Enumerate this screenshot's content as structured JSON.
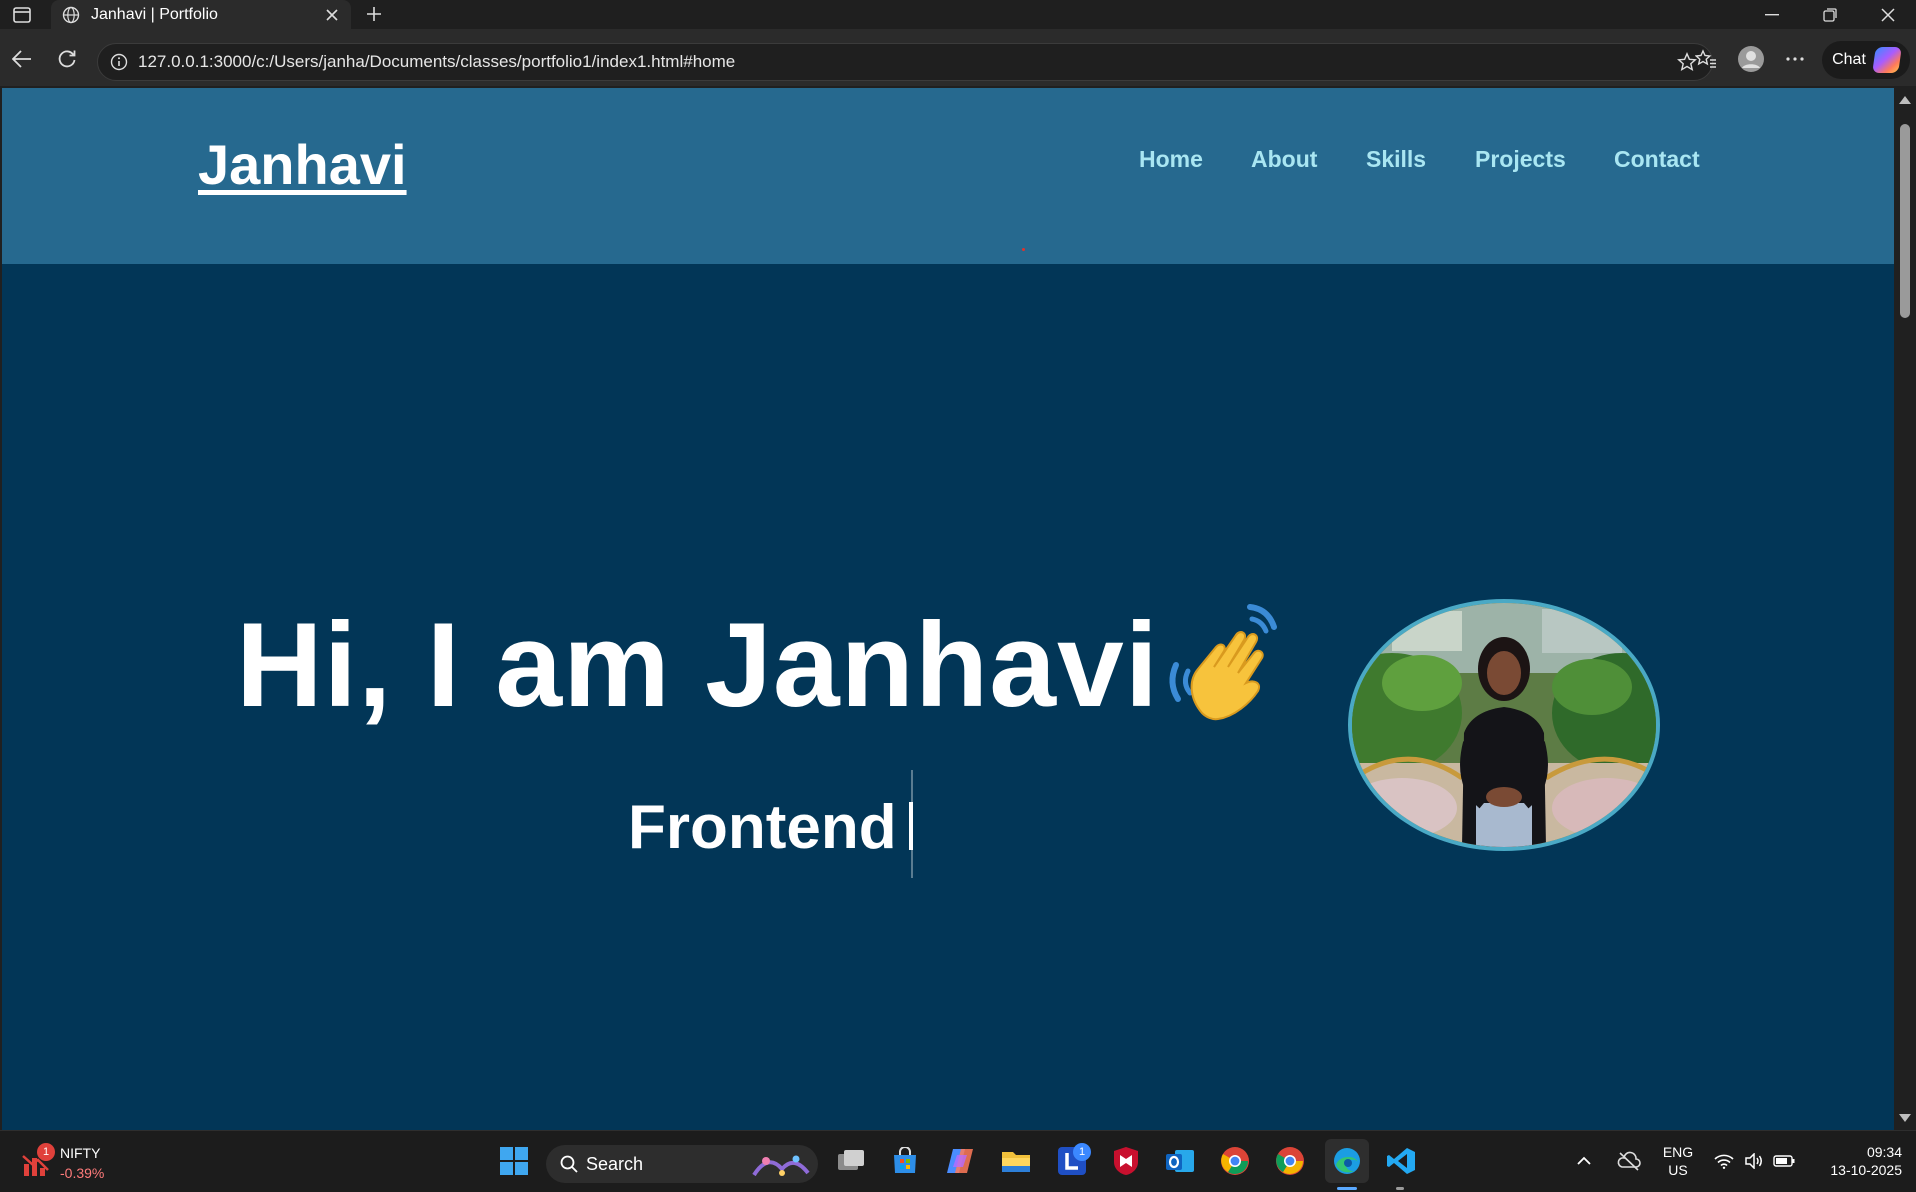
{
  "browser": {
    "tab_title": "Janhavi | Portfolio",
    "url": "127.0.0.1:3000/c:/Users/janha/Documents/classes/portfolio1/index1.html#home",
    "chat_label": "Chat"
  },
  "site": {
    "logo": "Janhavi",
    "nav": [
      "Home",
      "About",
      "Skills",
      "Projects",
      "Contact"
    ],
    "hero_title": "Hi, I am Janhavi",
    "typed_text": "Frontend",
    "colors": {
      "header_bg": "#26698f",
      "hero_bg": "#023657",
      "nav_text": "#a9e6f2",
      "avatar_border": "#4aa9c5"
    }
  },
  "taskbar": {
    "stock_name": "NIFTY",
    "stock_change": "-0.39%",
    "stock_badge": "1",
    "search_label": "Search",
    "lens_badge": "1",
    "lang_top": "ENG",
    "lang_bottom": "US",
    "time": "09:34",
    "date": "13-10-2025"
  }
}
